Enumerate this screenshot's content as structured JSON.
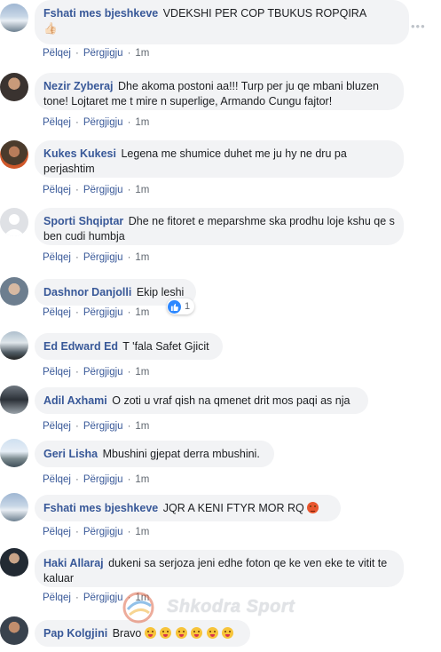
{
  "actions": {
    "like": "Pëlqej",
    "reply": "Përgjigju",
    "time": "1m"
  },
  "comments": [
    {
      "author": "Fshati mes bjeshkeve",
      "text": "VDEKSHI PER COP TBUKUS ROPQIRA",
      "extra": "👍🏻"
    },
    {
      "author": "Nezir Zyberaj",
      "text": "Dhe akoma postoni aa!!! Turp per ju qe mbani bluzen tone! Lojtaret me t mire n superlige, Armando Cungu fajtor!"
    },
    {
      "author": "Kukes Kukesi",
      "text": "Legena me shumice duhet me ju hy ne dru pa perjashtim"
    },
    {
      "author": "Sporti Shqiptar",
      "text": "Dhe ne fitoret e meparshme ska prodhu loje kshu qe s ben cudi humbja"
    },
    {
      "author": "Dashnor Danjolli",
      "text": "Ekip leshi",
      "reaction_count": "1"
    },
    {
      "author": "Ed Edward Ed",
      "text": "T 'fala Safet Gjicit"
    },
    {
      "author": "Adil Axhami",
      "text": "O zoti u vraf qish na qmenet drit mos paqi as nja"
    },
    {
      "author": "Geri Lisha",
      "text": "Mbushini gjepat derra mbushini."
    },
    {
      "author": "Fshati mes bjeshkeve",
      "text": "JQR A KENI FTYR MOR RQ",
      "emoji": "angry"
    },
    {
      "author": "Haki Allaraj",
      "text": "dukeni sa serjoza jeni edhe foton qe ke ven eke te vitit te kaluar"
    },
    {
      "author": "Pap Kolgjini",
      "text": "Bravo",
      "emoji_count": 6
    }
  ],
  "watermark": "Shkodra Sport",
  "colors": {
    "link": "#385898",
    "bubble": "#f2f3f5",
    "like_blue": "#2d88ff"
  }
}
